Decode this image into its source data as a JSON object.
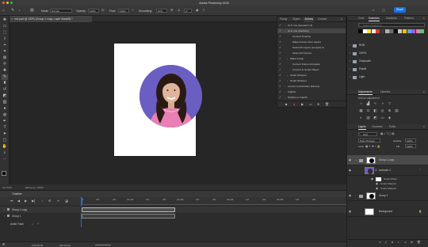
{
  "app_title": "Adobe Photoshop 2025",
  "options_bar": {
    "mode_label": "Mode:",
    "mode_value": "Normal",
    "opacity_label": "Opacity:",
    "opacity_value": "100%",
    "flow_label": "Flow:",
    "flow_value": "100%",
    "smoothing_label": "Smoothing:",
    "smoothing_value": "10%",
    "angle_value": "0°",
    "share_label": "Share"
  },
  "document_tab": "vo1.psd @ 102% (Group 1 copy, Layer Mask/8) *",
  "status_bar": {
    "zoom": "101.57%",
    "efficiency": "Efficiency: 100%*"
  },
  "timeline": {
    "panel_title": "Timeline",
    "ruler_ticks": [
      "00",
      "10f",
      "20f",
      "01:00f",
      "10f",
      "20f",
      "02:00f",
      "10f",
      "20f",
      "03:00f",
      "10f",
      "20f",
      "04:00f",
      "10f",
      "20f"
    ],
    "tracks": [
      {
        "name": "Group 1 copy"
      },
      {
        "name": "Group 1"
      },
      {
        "name": "Audio Track"
      }
    ],
    "timecode": "0:00:00:00",
    "fps": "(30.00 fps)"
  },
  "actions_panel": {
    "tabs": [
      "Paragr",
      "Glyphs",
      "Actions",
      "Comme"
    ],
    "active_tab": "Actions",
    "rows": [
      {
        "label": "AI in one (ipesadom 3)",
        "indent": 1,
        "expanded": true
      },
      {
        "label": "AI in one (shelvian)",
        "indent": 1,
        "expanded": true,
        "selected": true
      },
      {
        "label": "Convert Timeline",
        "indent": 3
      },
      {
        "label": "Make Frames from Layers",
        "indent": 3
      },
      {
        "label": "Select All Layers (Looped) fo...",
        "indent": 3
      },
      {
        "label": "Select All Frames",
        "indent": 3
      },
      {
        "label": "Make Group",
        "indent": 2
      },
      {
        "label": "Convert Frame Animation",
        "indent": 3
      },
      {
        "label": "Convert to Smart Object",
        "indent": 3
      },
      {
        "label": "Smart Sharpen",
        "indent": 2
      },
      {
        "label": "Smart Sharpen",
        "indent": 2
      },
      {
        "label": "convert to animation (frames)",
        "indent": 1
      },
      {
        "label": "brighter",
        "indent": 1
      },
      {
        "label": "Shrilled on Clarifix",
        "indent": 1
      }
    ]
  },
  "swatches_panel": {
    "tabs": [
      "Color",
      "Swatches",
      "Gradients",
      "Patterns"
    ],
    "active_tab": "Swatches",
    "search_placeholder": "Search Swatches",
    "colors": [
      "#000000",
      "#ffffff",
      "#f5e535",
      "#e8e8e8",
      "#d93a3a",
      "#3b3b3b",
      "#b0b0b0",
      "#6e6e6e",
      "#0a0a0a",
      "#c9c9c9",
      "#f2c200",
      "#5aa0ff",
      "#a35cd6",
      "#e57fb0",
      "#5bc96b"
    ],
    "folders": [
      "RGB",
      "CMYK",
      "Grayscale",
      "Pastel",
      "Light"
    ]
  },
  "adjustments_panel": {
    "tabs": [
      "Adjustments",
      "Libraries"
    ],
    "active_tab": "Adjustments",
    "subtitle": "Add an adjustment"
  },
  "layers_panel": {
    "tabs": [
      "Layers",
      "Channels",
      "Paths"
    ],
    "active_tab": "Layers",
    "kind_label": "Kind",
    "blend_mode": "Pass Through",
    "opacity_label": "Opacity:",
    "opacity_value": "100%",
    "lock_label": "Lock:",
    "fill_label": "Fill:",
    "fill_value": "100%",
    "layers": [
      {
        "name": "Group 1 copy",
        "selected": true
      },
      {
        "name": "example 4"
      },
      {
        "name": "Smart Filters"
      },
      {
        "name": "Smart Sharpen"
      },
      {
        "name": "Smart Sharpen"
      },
      {
        "name": "Group 1"
      },
      {
        "name": "Background"
      }
    ]
  },
  "tools": [
    "move-icon",
    "artboard-icon",
    "marquee-icon",
    "lasso-icon",
    "object-select-icon",
    "crop-icon",
    "frame-icon",
    "eyedropper-icon",
    "healing-icon",
    "brush-icon",
    "stamp-icon",
    "history-brush-icon",
    "eraser-icon",
    "gradient-icon",
    "blur-icon",
    "dodge-icon",
    "pen-icon",
    "type-icon",
    "path-select-icon",
    "rectangle-icon",
    "hand-icon",
    "zoom-icon",
    "more-tools-icon"
  ]
}
